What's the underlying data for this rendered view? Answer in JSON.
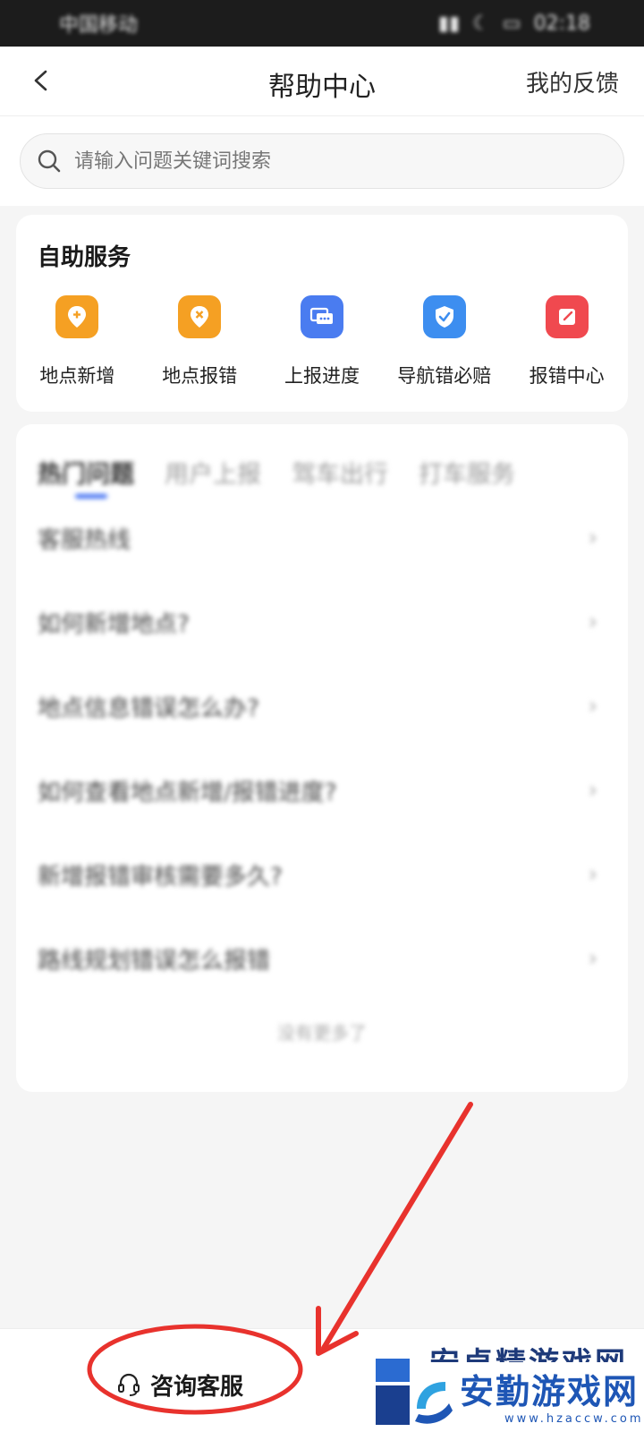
{
  "status_bar": {
    "carrier": "中国移动",
    "time": "02:18"
  },
  "header": {
    "title": "帮助中心",
    "feedback_label": "我的反馈"
  },
  "search": {
    "placeholder": "请输入问题关键词搜索"
  },
  "self_service": {
    "title": "自助服务",
    "items": [
      {
        "label": "地点新增",
        "icon": "location-add-icon",
        "color": "#f5a023"
      },
      {
        "label": "地点报错",
        "icon": "location-error-icon",
        "color": "#f5a023"
      },
      {
        "label": "上报进度",
        "icon": "progress-chat-icon",
        "color": "#4a7cf0"
      },
      {
        "label": "导航错必赔",
        "icon": "shield-check-icon",
        "color": "#3d8ef0"
      },
      {
        "label": "报错中心",
        "icon": "edit-report-icon",
        "color": "#f0494f"
      }
    ]
  },
  "faq": {
    "tabs": [
      "热门问题",
      "用户上报",
      "驾车出行",
      "打车服务"
    ],
    "active_tab": "热门问题",
    "accent": "#3d6df2",
    "items": [
      "客服热线",
      "如何新增地点?",
      "地点信息错误怎么办?",
      "如何查看地点新增/报错进度?",
      "新增报错审核需要多久?",
      "路线规划错误怎么报错"
    ],
    "no_more": "没有更多了"
  },
  "bottom": {
    "consult_label": "咨询客服",
    "consult_icon": "headset-icon"
  },
  "watermark": {
    "text": "安勤游戏网",
    "top_text": "安卓精游戏网",
    "url": "www.hzaccw.com"
  },
  "annotation_color": "#e8322d"
}
